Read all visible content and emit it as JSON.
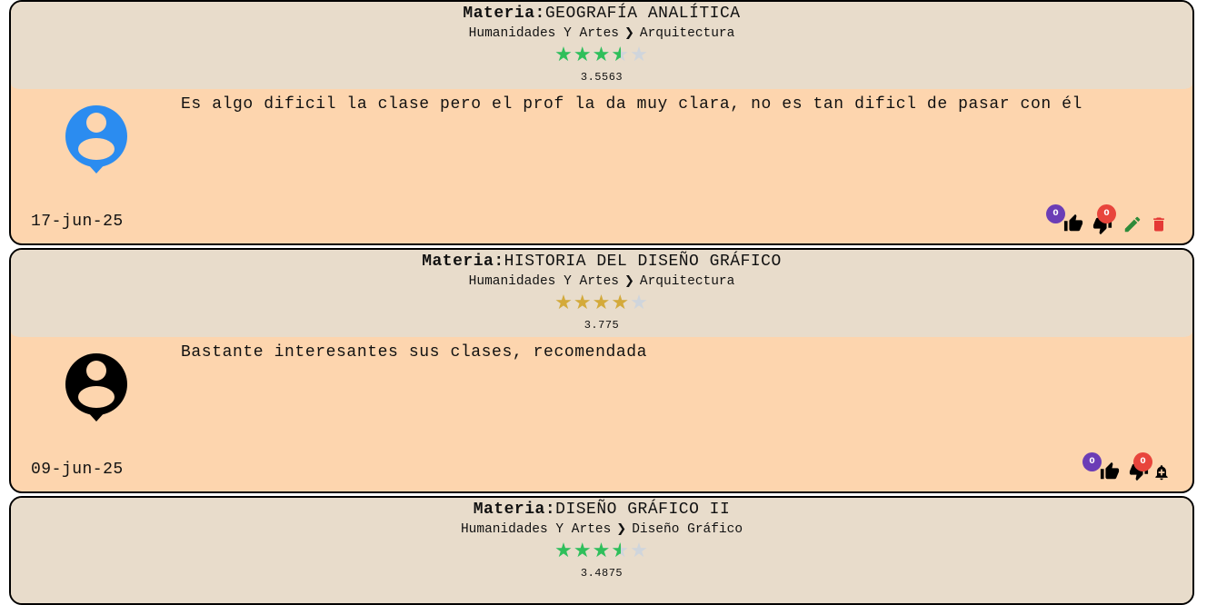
{
  "labels": {
    "materia": "Materia:"
  },
  "colors": {
    "star_green": "#2fbf5a",
    "star_gold": "#d4aa3a",
    "star_empty": "#cfd5dc"
  },
  "cards": [
    {
      "materia": "GEOGRAFÍA ANALÍTICA",
      "area": "Humanidades Y Artes",
      "career": "Arquitectura",
      "rating": 3.5563,
      "rating_text": "3.5563",
      "comment": "Es algo dificil la clase pero el prof la da muy clara, no es tan dificl de pasar con él",
      "date": "17-jun-25",
      "likes": "0",
      "dislikes": "0",
      "avatar_color": "#2b8cf0",
      "star_color": "#2fbf5a",
      "owner_actions": [
        "edit-icon",
        "delete-icon"
      ]
    },
    {
      "materia": "HISTORIA DEL DISEÑO GRÁFICO",
      "area": "Humanidades Y Artes",
      "career": "Arquitectura",
      "rating": 3.775,
      "rating_text": "3.775",
      "comment": "Bastante interesantes sus clases, recomendada",
      "date": "09-jun-25",
      "likes": "0",
      "dislikes": "0",
      "avatar_color": "#000000",
      "star_color": "#d4aa3a",
      "owner_actions": [
        "report-bell-icon"
      ]
    },
    {
      "materia": "DISEÑO GRÁFICO II",
      "area": "Humanidades Y Artes",
      "career": "Diseño Gráfico",
      "rating": 3.4875,
      "rating_text": "3.4875",
      "star_color": "#2fbf5a"
    }
  ]
}
